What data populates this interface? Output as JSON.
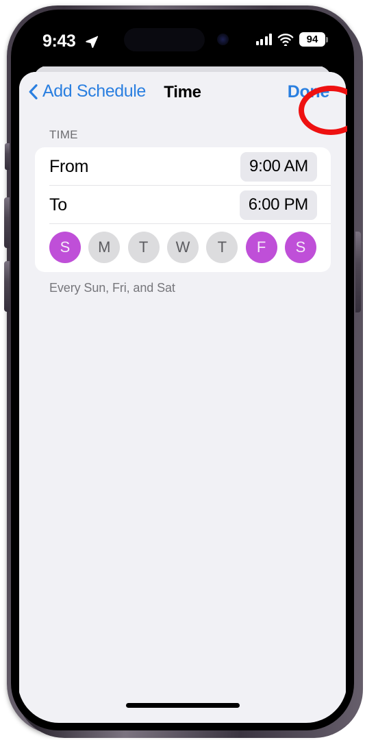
{
  "device": {
    "name": "iphone-14-pro",
    "frame_color": "#4b4350"
  },
  "status_bar": {
    "time": "9:43",
    "location_icon": "location-arrow-icon",
    "cellular_icon": "signal-bars-icon",
    "wifi_icon": "wifi-icon",
    "battery_level": "94",
    "battery_icon": "battery-icon"
  },
  "nav_bar": {
    "back_icon": "chevron-left-icon",
    "back_label": "Add Schedule",
    "title": "Time",
    "done_label": "Done",
    "tint_color": "#2a7fe0"
  },
  "content": {
    "section_header": "TIME",
    "rows": [
      {
        "label": "From",
        "value": "9:00 AM"
      },
      {
        "label": "To",
        "value": "6:00 PM"
      }
    ],
    "days": [
      {
        "letter": "S",
        "name": "Sunday",
        "selected": true
      },
      {
        "letter": "M",
        "name": "Monday",
        "selected": false
      },
      {
        "letter": "T",
        "name": "Tuesday",
        "selected": false
      },
      {
        "letter": "W",
        "name": "Wednesday",
        "selected": false
      },
      {
        "letter": "T",
        "name": "Thursday",
        "selected": false
      },
      {
        "letter": "F",
        "name": "Friday",
        "selected": true
      },
      {
        "letter": "S",
        "name": "Saturday",
        "selected": true
      }
    ],
    "footer_note": "Every Sun, Fri, and Sat",
    "selected_day_color": "#bf4fd8",
    "unselected_day_color": "#dcdcde"
  },
  "annotation": {
    "shape": "ellipse",
    "color": "#ee1111",
    "target": "done-button"
  }
}
